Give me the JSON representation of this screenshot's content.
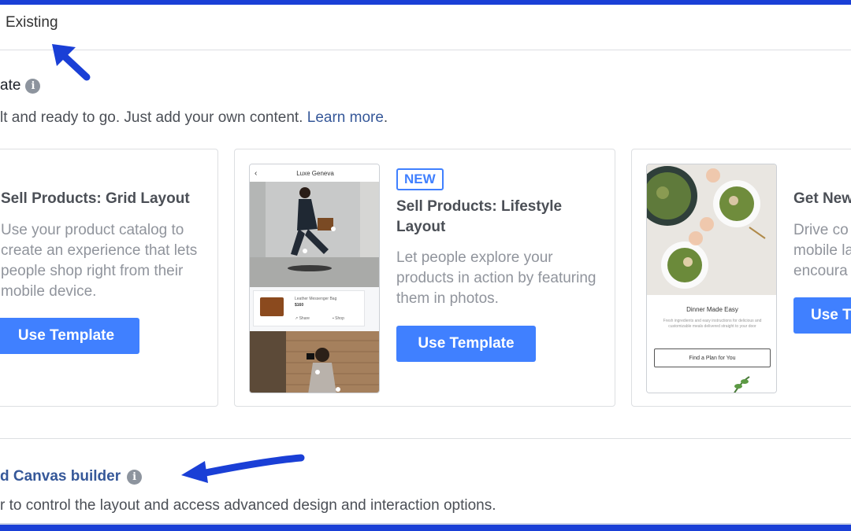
{
  "tabs": {
    "existing_label": "Existing"
  },
  "template_section": {
    "heading": "ate",
    "desc_text": "lt and ready to go. Just add your own content.",
    "learn_more": "Learn more",
    "learn_more_suffix": "."
  },
  "cards": [
    {
      "title": "Sell Products: Grid Layout",
      "desc": "Use your product catalog to create an experience that lets people shop right from their mobile device.",
      "button": "Use Template"
    },
    {
      "badge": "NEW",
      "title": "Sell Products: Lifestyle Layout",
      "desc": "Let people explore your products in action by featuring them in photos.",
      "button": "Use Template",
      "preview": {
        "header": "Luxe Geneva",
        "product_name": "Leather Messenger Bag",
        "product_price": "$160",
        "share": "Share",
        "shop": "Shop"
      }
    },
    {
      "title": "Get New",
      "desc_lines": [
        "Drive co",
        "mobile la",
        "encoura"
      ],
      "button": "Use T",
      "preview": {
        "title": "Dinner Made Easy",
        "body": "Fresh ingredients and easy instructions for delicious and customizable meals delivered straight to your door",
        "button": "Find a Plan for You"
      }
    }
  ],
  "canvas_section": {
    "heading": "d Canvas builder",
    "desc": "r to control the layout and access advanced design and interaction options."
  },
  "colors": {
    "accent": "#4080ff",
    "link": "#365899",
    "annotation_arrow": "#1a3fd6",
    "frame": "#1a3fd6"
  }
}
